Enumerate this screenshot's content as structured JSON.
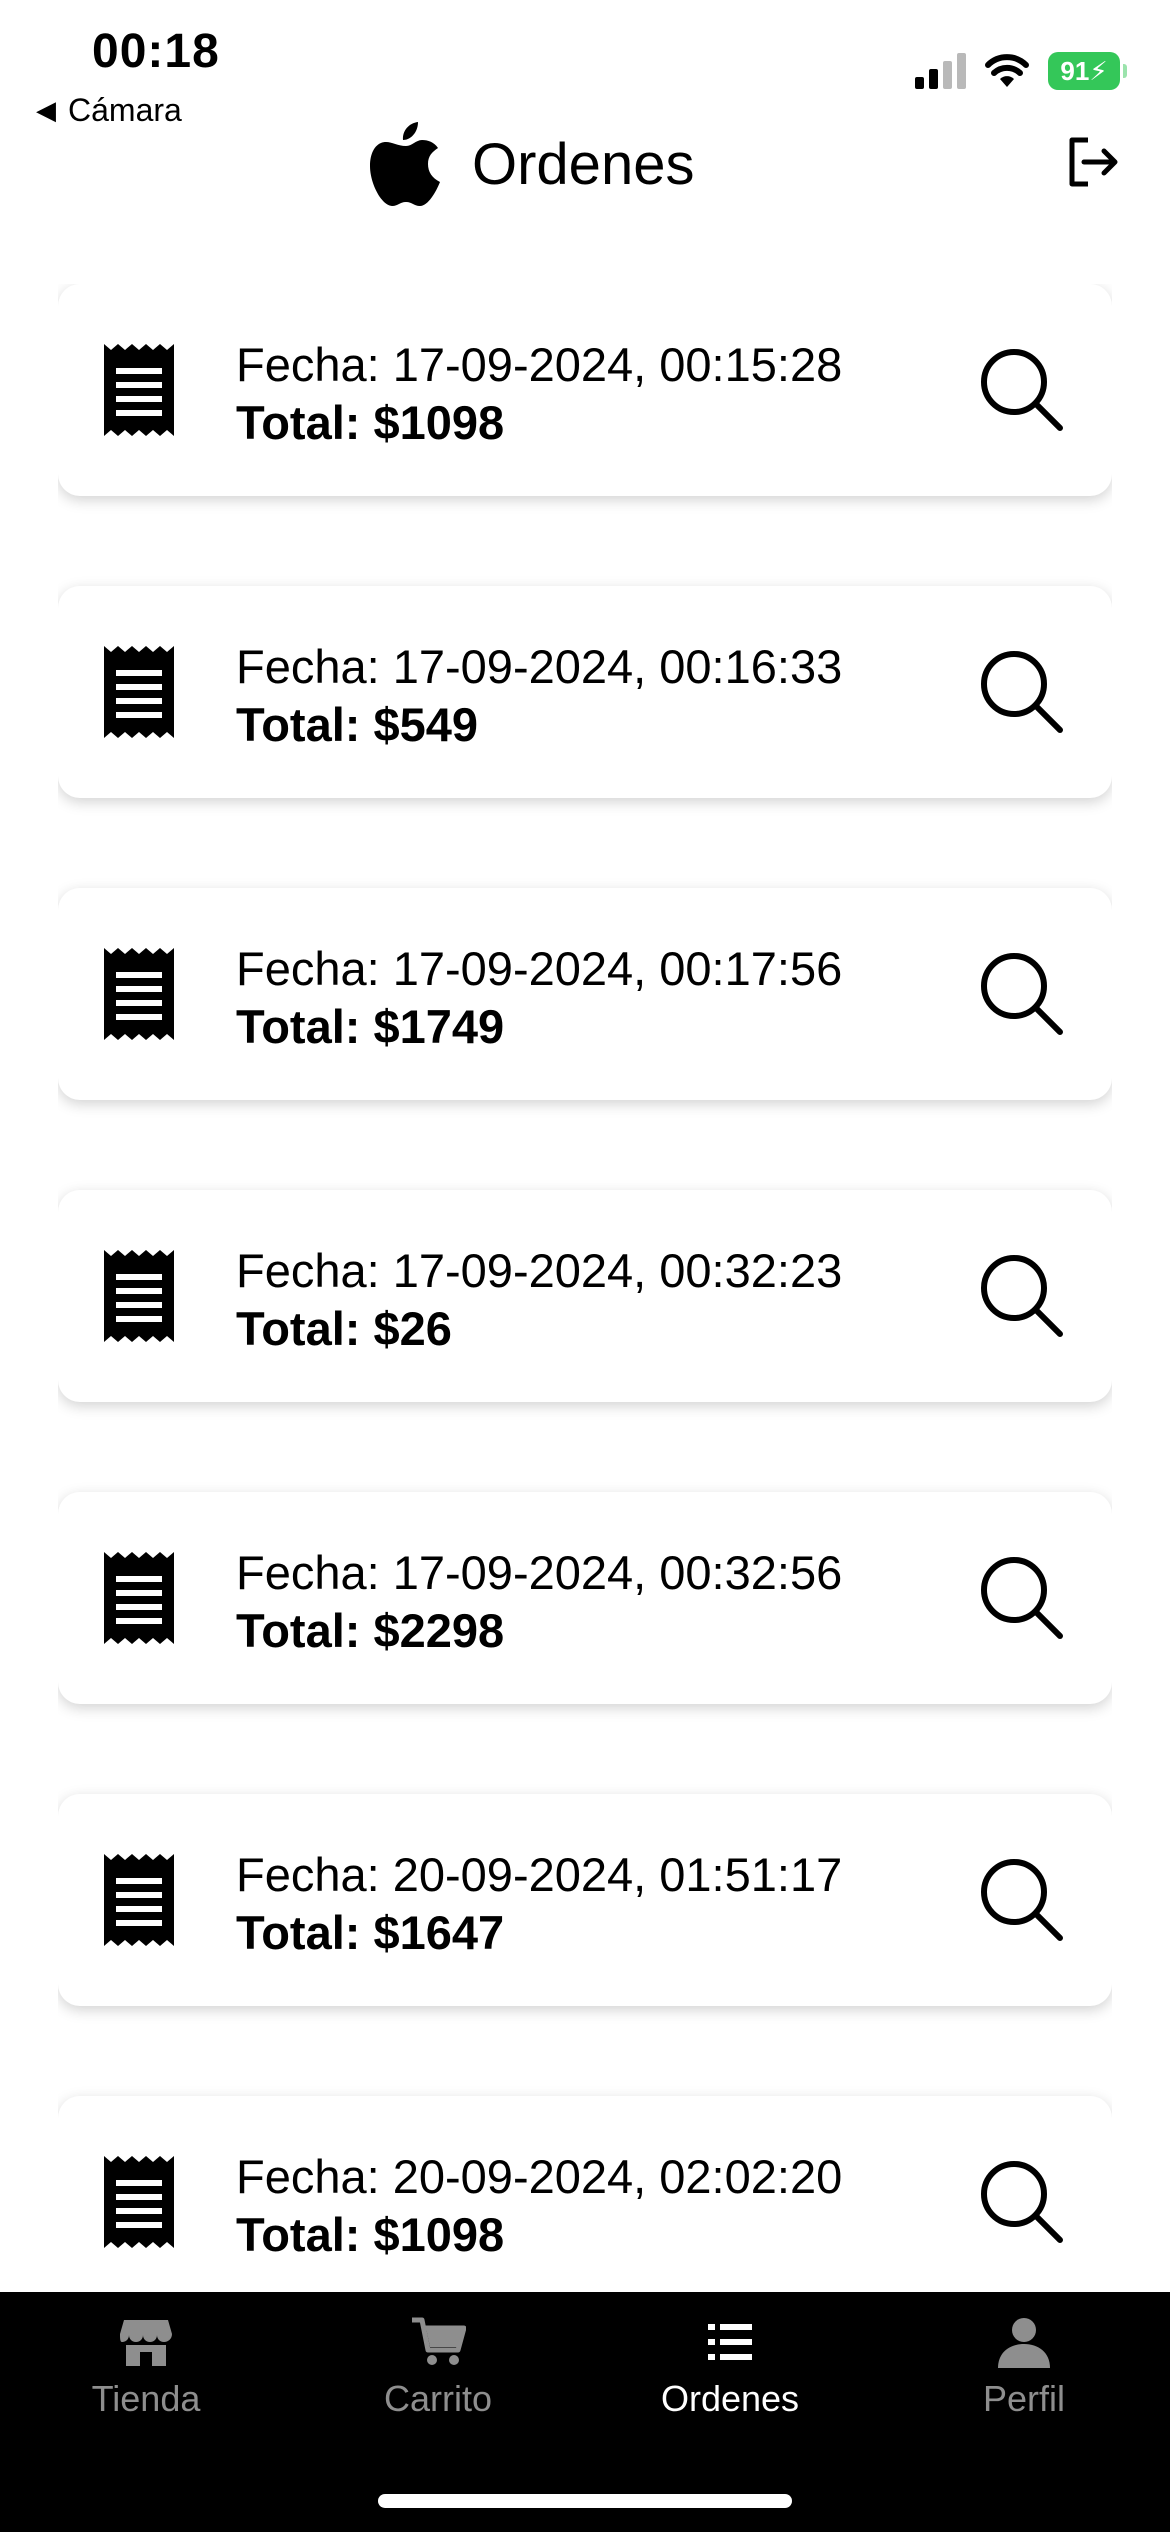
{
  "status_bar": {
    "time": "00:18",
    "back_label": "Cámara",
    "battery": "91"
  },
  "header": {
    "title": "Ordenes",
    "logo_icon": "apple-logo-icon",
    "logout_icon": "logout-icon"
  },
  "orders": [
    {
      "date": "Fecha: 17-09-2024, 00:15:28",
      "total": "Total: $1098"
    },
    {
      "date": "Fecha: 17-09-2024, 00:16:33",
      "total": "Total: $549"
    },
    {
      "date": "Fecha: 17-09-2024, 00:17:56",
      "total": "Total: $1749"
    },
    {
      "date": "Fecha: 17-09-2024, 00:32:23",
      "total": "Total: $26"
    },
    {
      "date": "Fecha: 17-09-2024, 00:32:56",
      "total": "Total: $2298"
    },
    {
      "date": "Fecha: 20-09-2024, 01:51:17",
      "total": "Total: $1647"
    },
    {
      "date": "Fecha: 20-09-2024, 02:02:20",
      "total": "Total: $1098"
    }
  ],
  "tabs": [
    {
      "label": "Tienda",
      "icon": "store-icon",
      "active": false
    },
    {
      "label": "Carrito",
      "icon": "cart-icon",
      "active": false
    },
    {
      "label": "Ordenes",
      "icon": "list-icon",
      "active": true
    },
    {
      "label": "Perfil",
      "icon": "person-icon",
      "active": false
    }
  ],
  "colors": {
    "battery": "#34c759",
    "tab_bar": "#000000",
    "tab_inactive": "#8e8e8e",
    "tab_active": "#ffffff"
  }
}
